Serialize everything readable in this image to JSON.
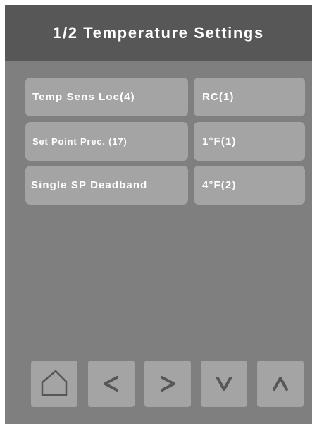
{
  "header": {
    "title": "1/2 Temperature Settings"
  },
  "settings": [
    {
      "label": "Temp Sens Loc(4)",
      "value": "RC(1)"
    },
    {
      "label": "Set Point Prec. (17)",
      "value": "1°F(1)"
    },
    {
      "label": "Single SP Deadband",
      "value": "4°F(2)"
    }
  ],
  "nav": {
    "buttons": [
      {
        "icon": "home-icon"
      },
      {
        "icon": "chevron-left-icon"
      },
      {
        "icon": "chevron-right-icon"
      },
      {
        "icon": "chevron-down-icon"
      },
      {
        "icon": "chevron-up-icon"
      }
    ]
  },
  "colors": {
    "background": "#7f7f7f",
    "header": "#575757",
    "cell": "#a4a4a4",
    "icon": "#575757",
    "text": "#ffffff"
  }
}
